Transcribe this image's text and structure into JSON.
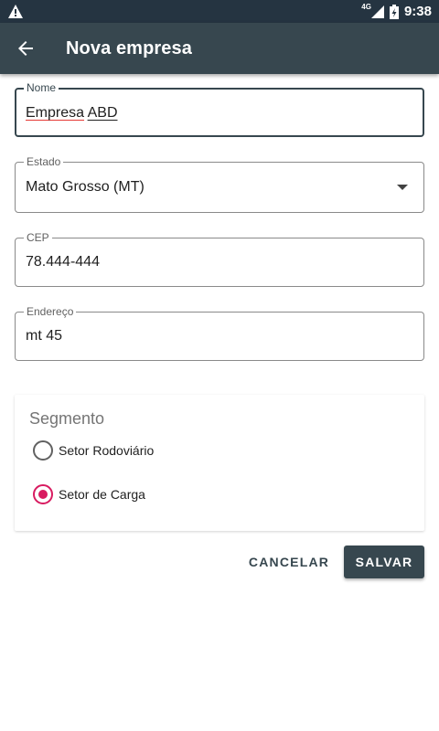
{
  "status_bar": {
    "network_label": "4G",
    "time": "9:38",
    "icons": [
      "warning-icon",
      "signal-icon",
      "battery-charging-icon"
    ]
  },
  "app_bar": {
    "title": "Nova empresa",
    "back_icon": "arrow-back-icon"
  },
  "form": {
    "nome": {
      "label": "Nome",
      "value_part1": "Empresa",
      "value_part2": "ABD"
    },
    "estado": {
      "label": "Estado",
      "value": "Mato Grosso (MT)"
    },
    "cep": {
      "label": "CEP",
      "value": "78.444-444"
    },
    "endereco": {
      "label": "Endereço",
      "value": "mt 45"
    }
  },
  "segmento": {
    "title": "Segmento",
    "options": [
      {
        "label": "Setor Rodoviário",
        "checked": false
      },
      {
        "label": "Setor de Carga",
        "checked": true
      }
    ]
  },
  "actions": {
    "cancel_label": "CANCELAR",
    "save_label": "SALVAR"
  },
  "colors": {
    "status_bar": "#253441",
    "app_bar": "#37474f",
    "accent": "#d81b60",
    "spellcheck": "#e53935"
  }
}
